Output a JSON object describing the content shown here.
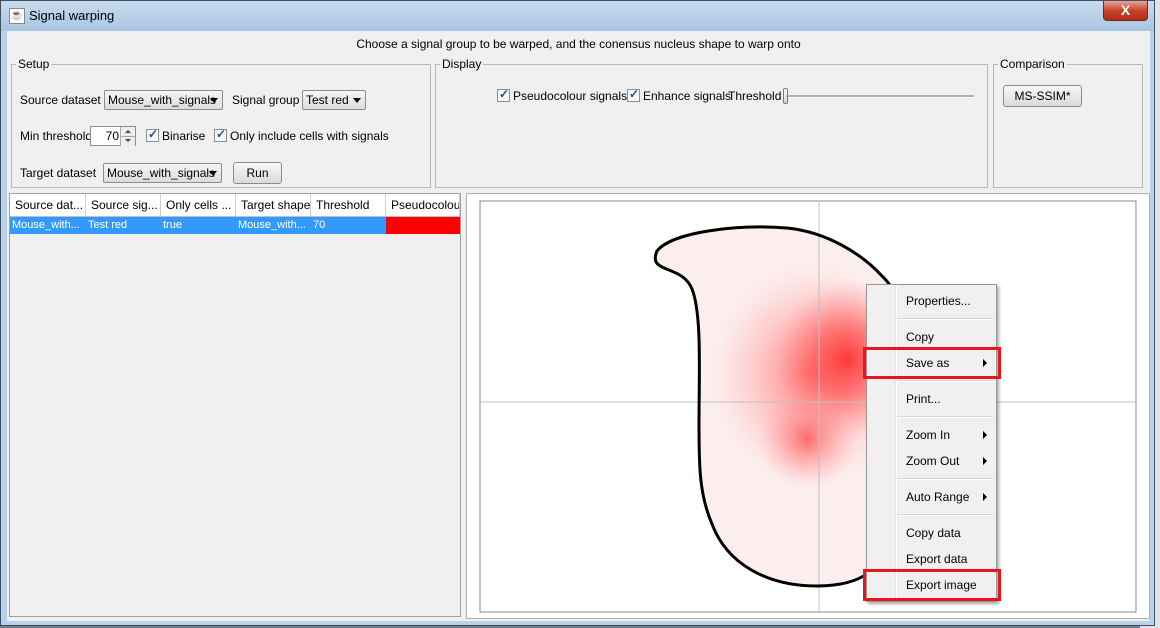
{
  "window": {
    "title": "Signal warping",
    "close_label": "X"
  },
  "instruction": "Choose a signal group to be warped, and the conensus nucleus shape to warp onto",
  "setup": {
    "legend": "Setup",
    "source_dataset_label": "Source dataset",
    "source_dataset_value": "Mouse_with_signals",
    "signal_group_label": "Signal group",
    "signal_group_value": "Test red",
    "min_threshold_label": "Min threshold",
    "min_threshold_value": "70",
    "binarise_label": "Binarise",
    "binarise_checked": true,
    "only_cells_label": "Only include cells with signals",
    "only_cells_checked": true,
    "target_dataset_label": "Target dataset",
    "target_dataset_value": "Mouse_with_signals",
    "run_label": "Run"
  },
  "display": {
    "legend": "Display",
    "pseudocolour_label": "Pseudocolour signals",
    "pseudocolour_checked": true,
    "enhance_label": "Enhance signals",
    "enhance_checked": true,
    "threshold_label": "Threshold",
    "threshold_level": 0
  },
  "comparison": {
    "legend": "Comparison",
    "ms_ssim_label": "MS-SSIM*"
  },
  "table": {
    "columns": [
      "Source dat...",
      "Source sig...",
      "Only cells ...",
      "Target shape",
      "Threshold",
      "Pseudocolour"
    ],
    "rows": [
      {
        "source_dataset": "Mouse_with...",
        "source_signal": "Test red",
        "only_cells": "true",
        "target_shape": "Mouse_with...",
        "threshold": "70",
        "pseudocolour": "#ff0000"
      }
    ]
  },
  "context_menu": {
    "items": [
      {
        "label": "Properties...",
        "submenu": false
      },
      {
        "label": "Copy",
        "submenu": false
      },
      {
        "label": "Save as",
        "submenu": true
      },
      {
        "label": "Print...",
        "submenu": false
      },
      {
        "label": "Zoom In",
        "submenu": true
      },
      {
        "label": "Zoom Out",
        "submenu": true
      },
      {
        "label": "Auto Range",
        "submenu": true
      },
      {
        "label": "Copy data",
        "submenu": false
      },
      {
        "label": "Export data",
        "submenu": false
      },
      {
        "label": "Export image",
        "submenu": false
      }
    ],
    "highlighted": [
      "Save as",
      "Export image"
    ]
  },
  "colors": {
    "highlight_box": "#e8151f",
    "selection_row": "#3399ff",
    "pseudocolour": "#ff0000",
    "signal_red": "#ff3030"
  }
}
